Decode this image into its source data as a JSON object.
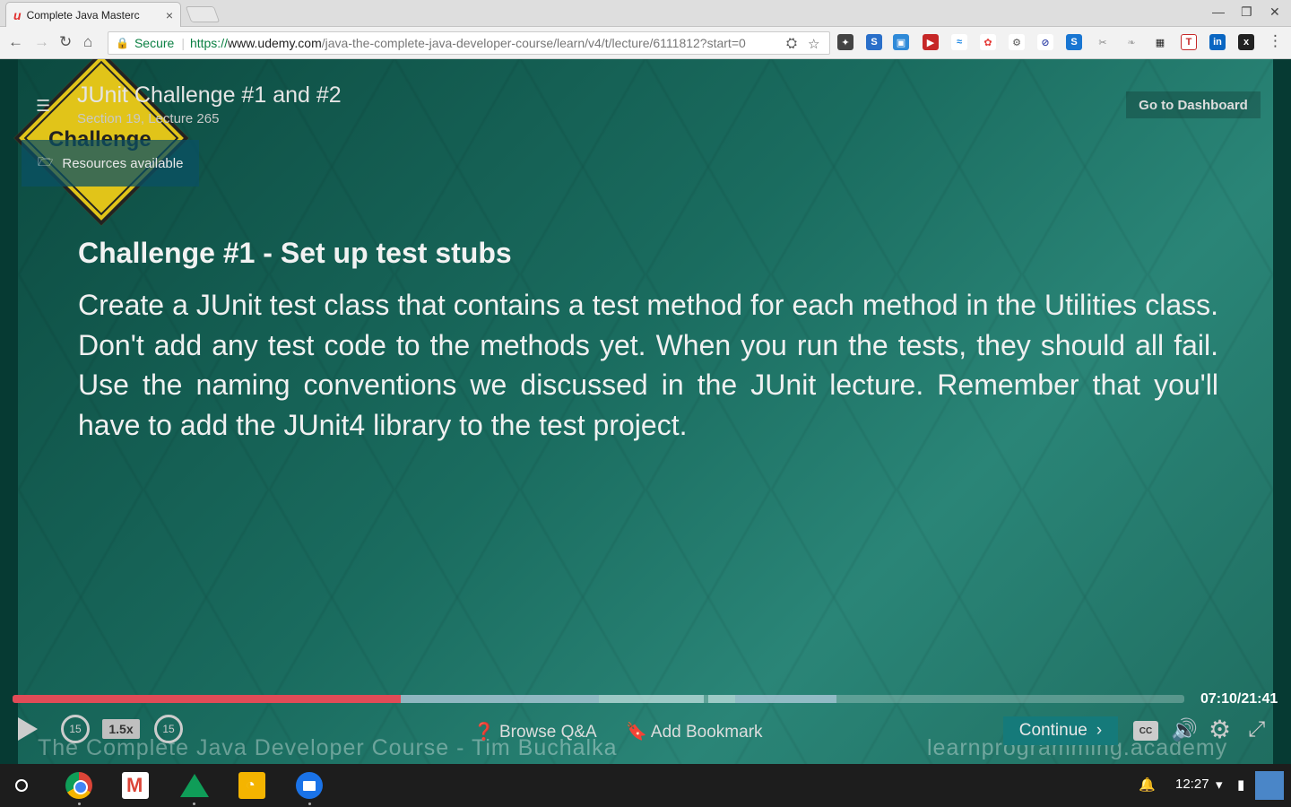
{
  "browser": {
    "tab_title": "Complete Java Masterc",
    "tab_close": "×",
    "omnibox": {
      "secure_label": "Secure",
      "url_scheme": "https://",
      "url_host": "www.udemy.com",
      "url_path": "/java-the-complete-java-developer-course/learn/v4/t/lecture/6111812?start=0"
    }
  },
  "lecture": {
    "title": "JUnit Challenge #1 and #2",
    "subtitle": "Section 19, Lecture 265",
    "dashboard_label": "Go to Dashboard",
    "resources_label": "Resources available",
    "sign_label": "Challenge"
  },
  "slide": {
    "heading": "Challenge #1 - Set up test stubs",
    "body": "Create a JUnit test class that contains a test method for each method in the Utilities class. Don't add any test code to the methods yet. When you run the tests, they should all fail. Use the naming conventions we discussed in the JUnit lecture. Remember that you'll have to add the JUnit4 library to the test project.",
    "watermark_left": "The Complete Java Developer Course - Tim Buchalka",
    "watermark_right": "learnprogramming.academy"
  },
  "player": {
    "progress_fraction": 0.331,
    "timecode": "07:10/21:41",
    "rewind_label": "15",
    "forward_label": "15",
    "speed_label": "1.5x",
    "qa_label": "Browse Q&A",
    "bookmark_label": "Add Bookmark",
    "continue_label": "Continue",
    "cc_label": "CC"
  },
  "shelf": {
    "time": "12:27"
  },
  "colors": {
    "progress": "#e14b57",
    "continue_bg": "#157a7a",
    "secure": "#0b8043"
  }
}
